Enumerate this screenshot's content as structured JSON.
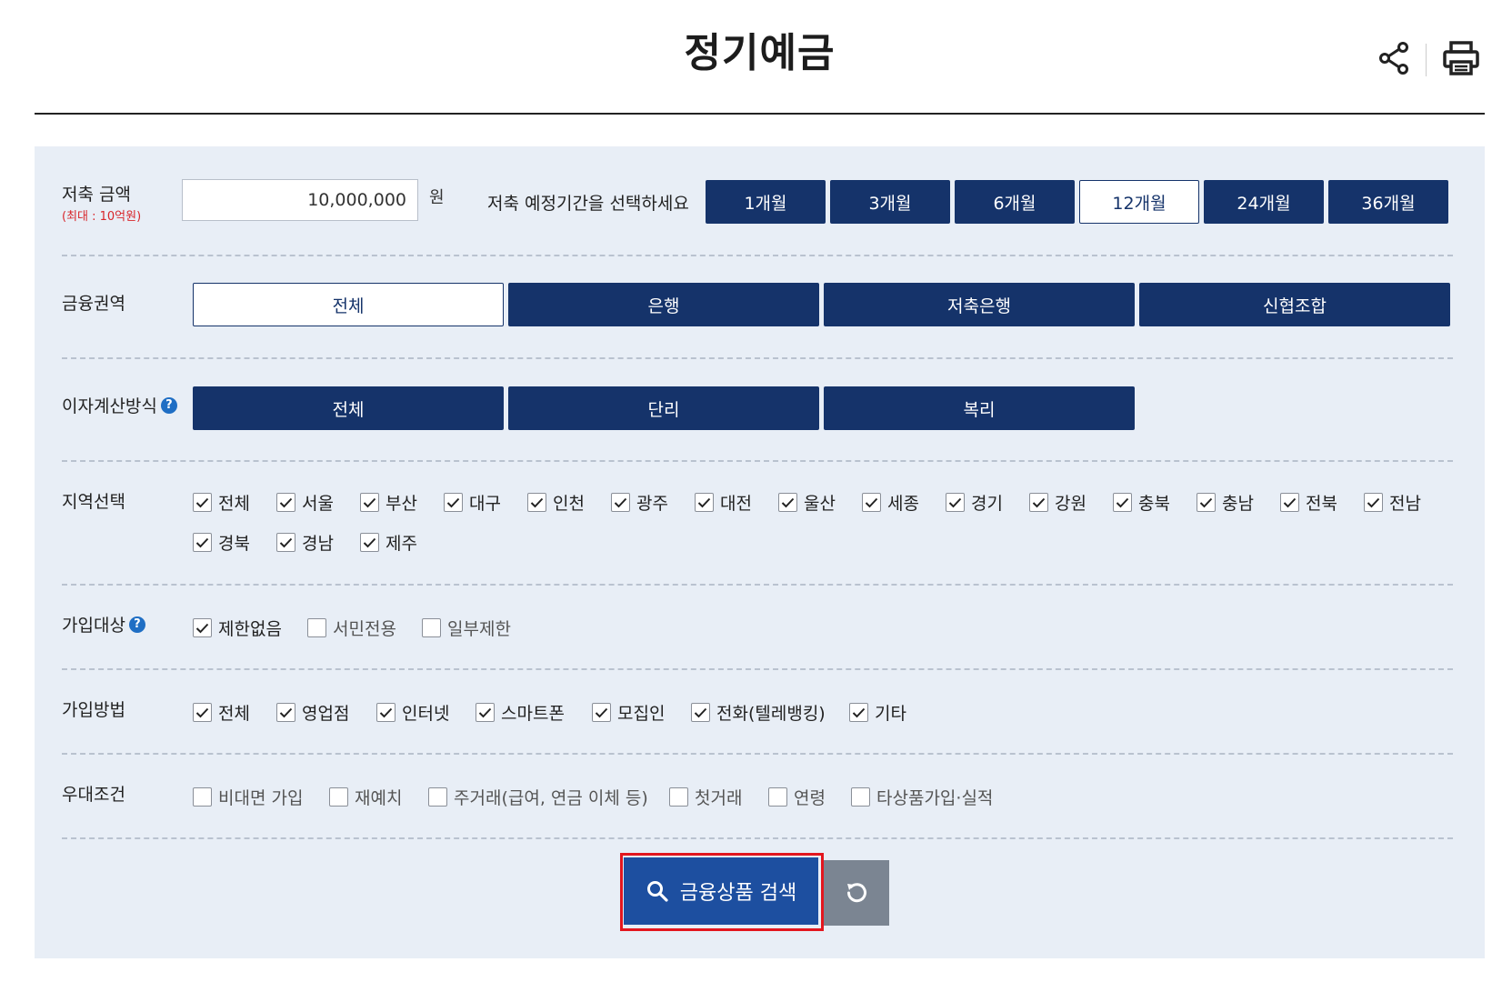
{
  "header": {
    "title": "정기예금",
    "share_icon": "share-icon",
    "print_icon": "print-icon"
  },
  "form": {
    "amount": {
      "label": "저축 금액",
      "sublabel": "(최대 : 10억원)",
      "value": "10,000,000",
      "unit": "원"
    },
    "period": {
      "label": "저축 예정기간을 선택하세요",
      "options": [
        "1개월",
        "3개월",
        "6개월",
        "12개월",
        "24개월",
        "36개월"
      ],
      "selected": "12개월"
    },
    "sector": {
      "label": "금융권역",
      "options": [
        "전체",
        "은행",
        "저축은행",
        "신협조합"
      ],
      "selected": "전체"
    },
    "interest": {
      "label": "이자계산방식",
      "help": "?",
      "options": [
        "전체",
        "단리",
        "복리"
      ]
    },
    "region": {
      "label": "지역선택",
      "options": [
        "전체",
        "서울",
        "부산",
        "대구",
        "인천",
        "광주",
        "대전",
        "울산",
        "세종",
        "경기",
        "강원",
        "충북",
        "충남",
        "전북",
        "전남",
        "경북",
        "경남",
        "제주"
      ]
    },
    "target": {
      "label": "가입대상",
      "help": "?",
      "options": [
        "제한없음",
        "서민전용",
        "일부제한"
      ],
      "checked": [
        true,
        false,
        false
      ]
    },
    "method": {
      "label": "가입방법",
      "options": [
        "전체",
        "영업점",
        "인터넷",
        "스마트폰",
        "모집인",
        "전화(텔레뱅킹)",
        "기타"
      ]
    },
    "benefit": {
      "label": "우대조건",
      "options": [
        "비대면 가입",
        "재예치",
        "주거래(급여, 연금 이체 등)",
        "첫거래",
        "연령",
        "타상품가입·실적"
      ]
    }
  },
  "actions": {
    "search_label": "금융상품 검색",
    "search_icon": "search-icon",
    "reset_icon": "refresh-icon"
  },
  "colors": {
    "navy": "#15336a",
    "panel": "#e8eef6",
    "search": "#1d4fa0",
    "reset": "#7b8592",
    "highlight": "#e3161e",
    "help": "#1f6ec4"
  }
}
